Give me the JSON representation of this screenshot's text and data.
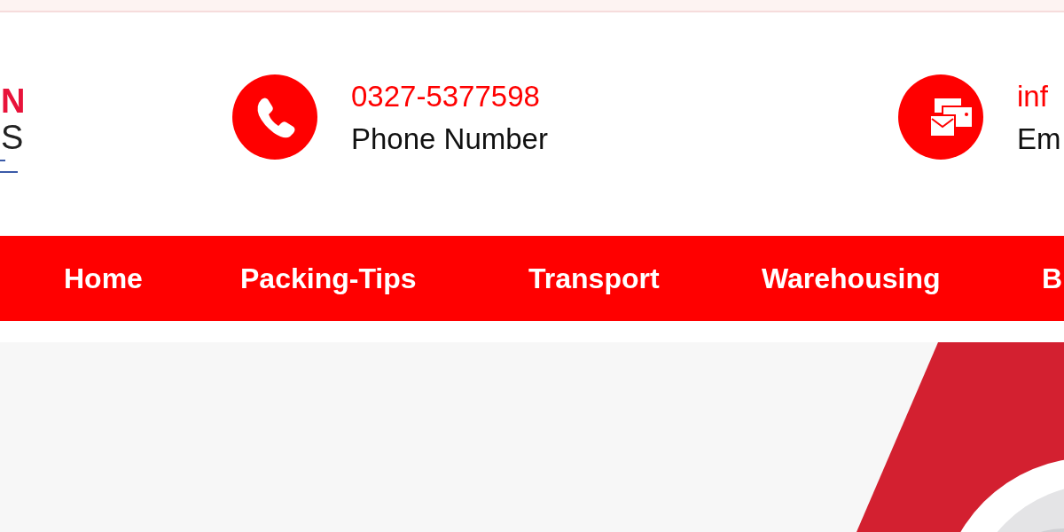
{
  "logo": {
    "line_1": "N",
    "line_2": "S"
  },
  "contacts": [
    {
      "kind": "phone",
      "value": "0327-5377598",
      "label": "Phone Number"
    },
    {
      "kind": "email",
      "value": "inf",
      "label": "Em"
    }
  ],
  "nav": [
    {
      "label": "Home"
    },
    {
      "label": "Packing-Tips"
    },
    {
      "label": "Transport"
    },
    {
      "label": "Warehousing"
    },
    {
      "label": "B"
    }
  ]
}
